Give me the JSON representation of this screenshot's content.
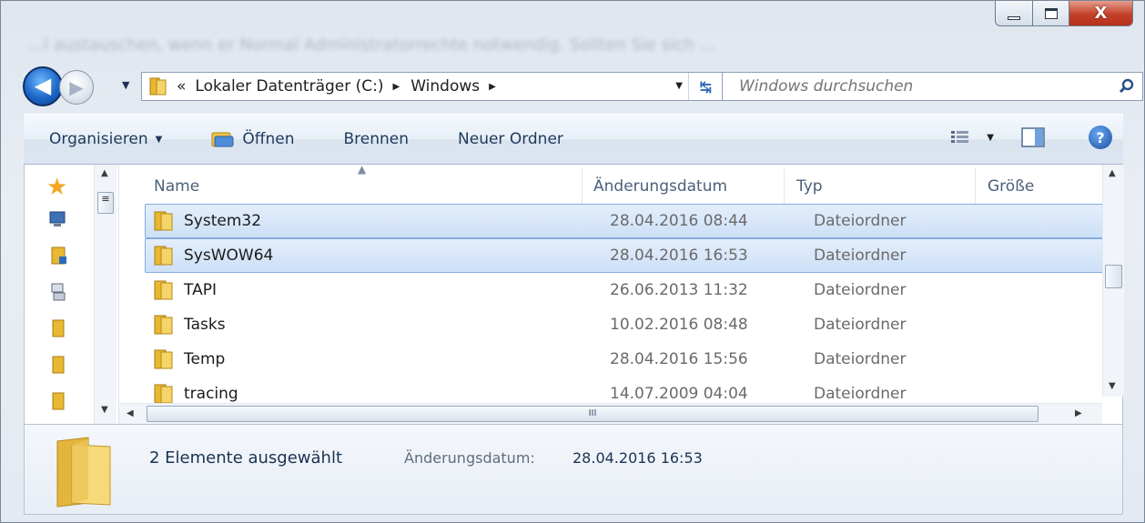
{
  "window": {
    "close_glyph": "X",
    "background_blur_text": "...l austauschen, wenn er Normal Administratorrechte notwendig. Sollten Sie sich ..."
  },
  "nav": {
    "back_icon": "arrow-left-icon",
    "forward_icon": "arrow-right-icon",
    "breadcrumbs": [
      {
        "label": "«"
      },
      {
        "label": "Lokaler Datenträger (C:)"
      },
      {
        "label": "Windows"
      }
    ],
    "search_placeholder": "Windows durchsuchen"
  },
  "toolbar": {
    "organize": "Organisieren",
    "open": "Öffnen",
    "burn": "Brennen",
    "new_folder": "Neuer Ordner"
  },
  "columns": {
    "name": "Name",
    "date": "Änderungsdatum",
    "type": "Typ",
    "size": "Größe"
  },
  "files": [
    {
      "name": "System32",
      "date": "28.04.2016 08:44",
      "type": "Dateiordner",
      "selected": true
    },
    {
      "name": "SysWOW64",
      "date": "28.04.2016 16:53",
      "type": "Dateiordner",
      "selected": true
    },
    {
      "name": "TAPI",
      "date": "26.06.2013 11:32",
      "type": "Dateiordner",
      "selected": false
    },
    {
      "name": "Tasks",
      "date": "10.02.2016 08:48",
      "type": "Dateiordner",
      "selected": false
    },
    {
      "name": "Temp",
      "date": "28.04.2016 15:56",
      "type": "Dateiordner",
      "selected": false
    },
    {
      "name": "tracing",
      "date": "14.07.2009 04:04",
      "type": "Dateiordner",
      "selected": false
    }
  ],
  "hscroll_grip": "III",
  "details": {
    "selection": "2 Elemente ausgewählt",
    "date_label": "Änderungsdatum:",
    "date_value": "28.04.2016 16:53"
  },
  "colors": {
    "selection_fill": "#cde0f7",
    "selection_border": "#84acdd",
    "toolbar_text": "#1e395b",
    "close_red": "#c3412a"
  }
}
